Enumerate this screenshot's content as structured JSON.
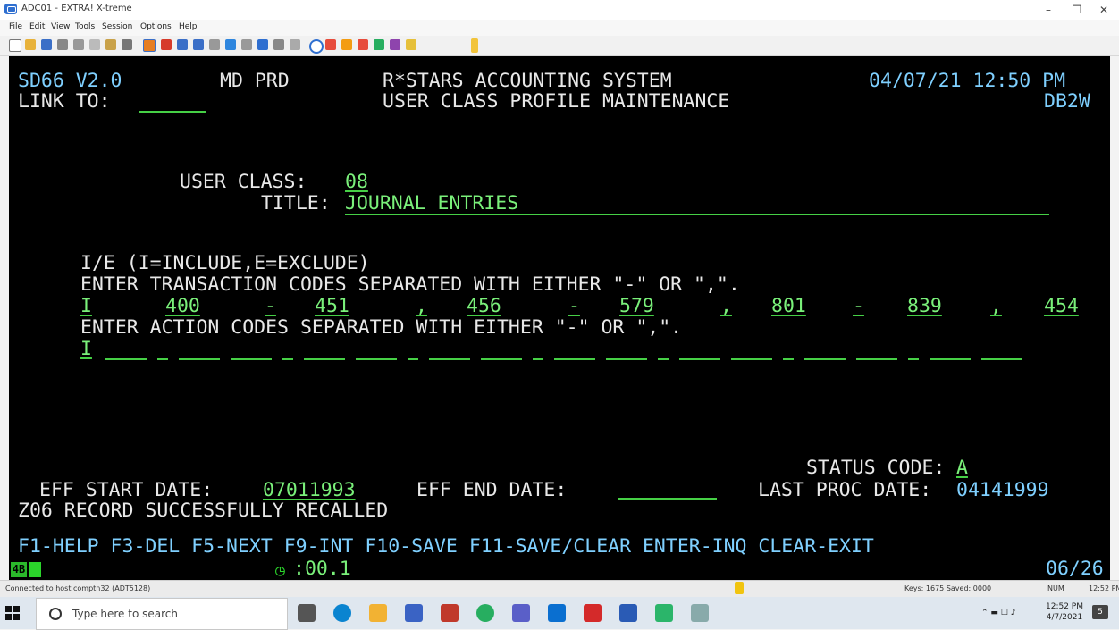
{
  "window": {
    "title": "ADC01 - EXTRA! X-treme",
    "minimize": "–",
    "restore": "❐",
    "close": "✕"
  },
  "menu": [
    "File",
    "Edit",
    "View",
    "Tools",
    "Session",
    "Options",
    "Help"
  ],
  "screen": {
    "line1": {
      "left": "SD66 V2.0",
      "region": "MD PRD",
      "system": "R*STARS ACCOUNTING SYSTEM",
      "datetime": "04/07/21 12:50 PM"
    },
    "line2": {
      "link_label": "LINK TO:",
      "link_value": "",
      "screen_title": "USER CLASS PROFILE MAINTENANCE",
      "db": "DB2W"
    },
    "user_class_label": "USER CLASS:",
    "user_class_value": "08",
    "title_label": "TITLE:",
    "title_value": "JOURNAL ENTRIES",
    "ie_help": "I/E (I=INCLUDE,E=EXCLUDE)",
    "trans_instruction": "ENTER TRANSACTION CODES SEPARATED WITH EITHER \"-\" OR \",\".",
    "trans_row": {
      "ie": "I",
      "items": [
        "400",
        "-",
        "451",
        ",",
        "456",
        "-",
        "579",
        ",",
        "801",
        "-",
        "839",
        ",",
        "454"
      ]
    },
    "action_instruction": "ENTER ACTION CODES SEPARATED WITH EITHER \"-\" OR \",\".",
    "action_row_ie": "I",
    "status_code_label": "STATUS CODE:",
    "status_code_value": "A",
    "eff_start_label": "EFF START DATE:",
    "eff_start_value": "07011993",
    "eff_end_label": "EFF END DATE:",
    "eff_end_value": "",
    "last_proc_label": "LAST PROC DATE:",
    "last_proc_value": "04141999",
    "message": "Z06 RECORD SUCCESSFULLY RECALLED",
    "fkeys": "F1-HELP F3-DEL F5-NEXT F9-INT F10-SAVE F11-SAVE/CLEAR ENTER-INQ CLEAR-EXIT",
    "oia_session": "4B",
    "oia_timer": ":00.1",
    "cursor_pos": "06/26"
  },
  "host_status": {
    "connection": "Connected to host comptn32 (ADT5128)",
    "keys": "Keys: 1675 Saved: 0000",
    "num": "NUM",
    "time": "12:52 PM"
  },
  "taskbar": {
    "search_placeholder": "Type here to search",
    "clock_time": "12:52 PM",
    "clock_date": "4/7/2021",
    "notification_count": "5"
  },
  "colors": {
    "terminal_bg": "#000000",
    "field_green": "#7af07a",
    "header_cyan": "#7fd0ff"
  }
}
